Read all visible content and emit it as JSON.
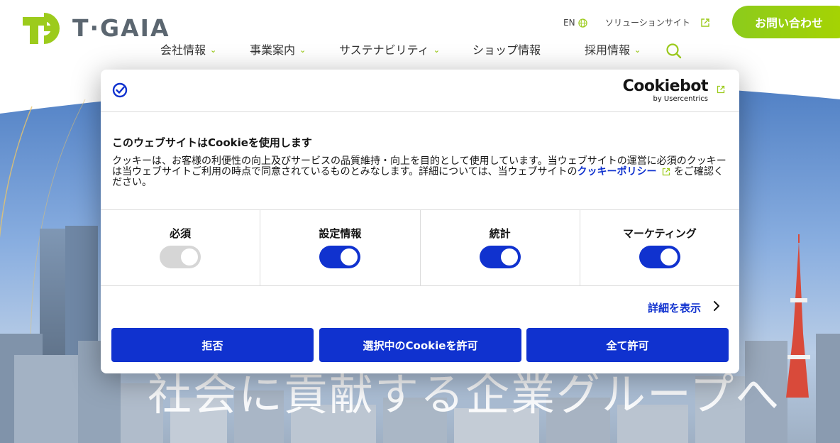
{
  "header": {
    "logo_text": "T·GAIA",
    "lang_label": "EN",
    "solution_site_label": "ソリューションサイト",
    "contact_label": "お問い合わせ",
    "nav": [
      {
        "label": "会社情報"
      },
      {
        "label": "事業案内"
      },
      {
        "label": "サステナビリティ"
      },
      {
        "label": "ショップ情報"
      },
      {
        "label": "採用情報"
      }
    ]
  },
  "hero": {
    "tagline": "社会に貢献する企業グループへ"
  },
  "cookie_dialog": {
    "brand_main": "Cookiebot",
    "brand_sub": "by Usercentrics",
    "title": "このウェブサイトはCookieを使用します",
    "body_text": "クッキーは、お客様の利便性の向上及びサービスの品質維持・向上を目的として使用しています。当ウェブサイトの運営に必須のクッキーは当ウェブサイトご利用の時点で同意されているものとみなします。詳細については、当ウェブサイトの",
    "policy_link": "クッキーポリシー",
    "body_suffix": "をご確認ください。",
    "categories": [
      {
        "label": "必須",
        "enabled": true,
        "locked": true
      },
      {
        "label": "設定情報",
        "enabled": true,
        "locked": false
      },
      {
        "label": "統計",
        "enabled": true,
        "locked": false
      },
      {
        "label": "マーケティング",
        "enabled": true,
        "locked": false
      }
    ],
    "details_label": "詳細を表示",
    "deny_label": "拒否",
    "allow_selection_label": "選択中のCookieを許可",
    "allow_all_label": "全て許可",
    "colors": {
      "primary": "#1032cf",
      "toggle_locked": "#d6d6d6"
    }
  },
  "colors": {
    "brand_green": "#9ccb1c",
    "logo_gray": "#5b6670"
  }
}
